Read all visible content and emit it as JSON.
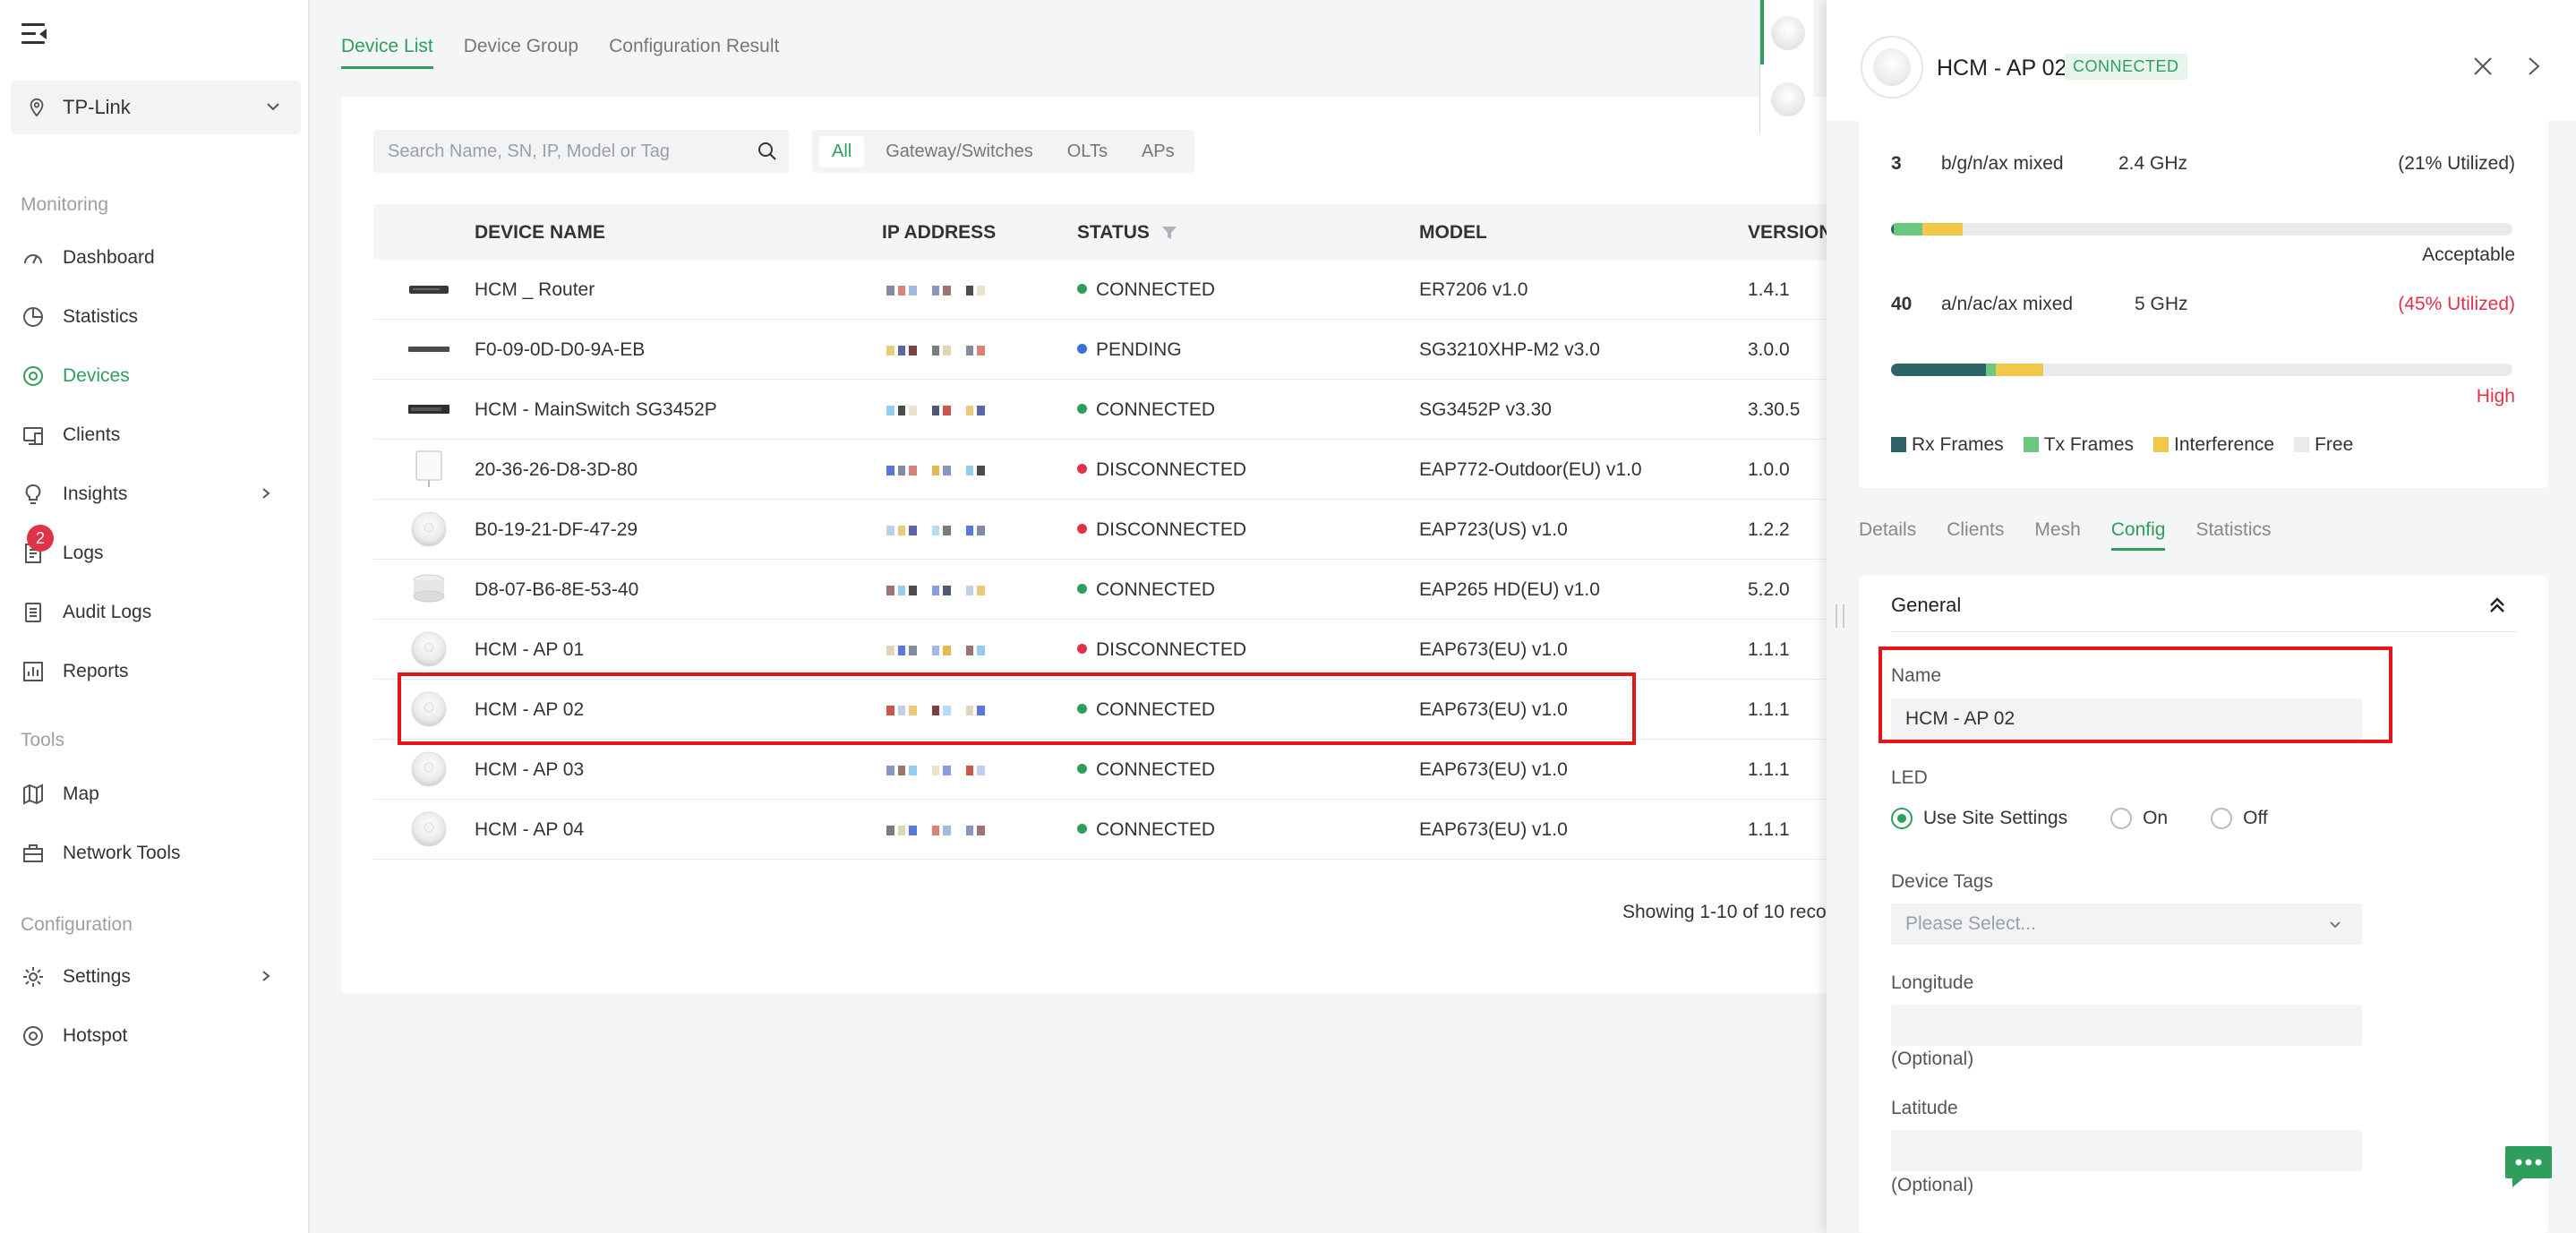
{
  "site": {
    "name": "TP-Link"
  },
  "nav": {
    "sections": {
      "monitoring": "Monitoring",
      "tools": "Tools",
      "configuration": "Configuration"
    },
    "items": [
      {
        "label": "Dashboard",
        "icon": "dashboard-icon"
      },
      {
        "label": "Statistics",
        "icon": "pie-chart-icon"
      },
      {
        "label": "Devices",
        "icon": "devices-icon",
        "active": true
      },
      {
        "label": "Clients",
        "icon": "clients-icon"
      },
      {
        "label": "Insights",
        "icon": "lightbulb-icon"
      },
      {
        "label": "Logs",
        "icon": "logs-icon",
        "badge": "2"
      },
      {
        "label": "Audit Logs",
        "icon": "audit-icon"
      },
      {
        "label": "Reports",
        "icon": "reports-icon"
      },
      {
        "label": "Map",
        "icon": "map-icon"
      },
      {
        "label": "Network Tools",
        "icon": "toolbox-icon"
      },
      {
        "label": "Settings",
        "icon": "gear-icon"
      },
      {
        "label": "Hotspot",
        "icon": "hotspot-icon"
      }
    ]
  },
  "tabs": [
    "Device List",
    "Device Group",
    "Configuration Result"
  ],
  "search": {
    "placeholder": "Search Name, SN, IP, Model or Tag"
  },
  "filters": [
    "All",
    "Gateway/Switches",
    "OLTs",
    "APs"
  ],
  "table": {
    "headers": {
      "name": "DEVICE NAME",
      "ip": "IP ADDRESS",
      "status": "STATUS",
      "model": "MODEL",
      "version": "VERSION"
    },
    "rows": [
      {
        "name": "HCM _ Router",
        "status": "CONNECTED",
        "model": "ER7206 v1.0",
        "version": "1.4.1",
        "kind": "router"
      },
      {
        "name": "F0-09-0D-D0-9A-EB",
        "status": "PENDING",
        "model": "SG3210XHP-M2 v3.0",
        "version": "3.0.0",
        "kind": "switch-small"
      },
      {
        "name": "HCM - MainSwitch SG3452P",
        "status": "CONNECTED",
        "model": "SG3452P v3.30",
        "version": "3.30.5",
        "kind": "switch"
      },
      {
        "name": "20-36-26-D8-3D-80",
        "status": "DISCONNECTED",
        "model": "EAP772-Outdoor(EU) v1.0",
        "version": "1.0.0",
        "kind": "outdoor"
      },
      {
        "name": "B0-19-21-DF-47-29",
        "status": "DISCONNECTED",
        "model": "EAP723(US) v1.0",
        "version": "1.2.2",
        "kind": "ap"
      },
      {
        "name": "D8-07-B6-8E-53-40",
        "status": "CONNECTED",
        "model": "EAP265 HD(EU) v1.0",
        "version": "5.2.0",
        "kind": "ap-stack"
      },
      {
        "name": "HCM - AP 01",
        "status": "DISCONNECTED",
        "model": "EAP673(EU) v1.0",
        "version": "1.1.1",
        "kind": "ap"
      },
      {
        "name": "HCM - AP 02",
        "status": "CONNECTED",
        "model": "EAP673(EU) v1.0",
        "version": "1.1.1",
        "kind": "ap"
      },
      {
        "name": "HCM - AP 03",
        "status": "CONNECTED",
        "model": "EAP673(EU) v1.0",
        "version": "1.1.1",
        "kind": "ap"
      },
      {
        "name": "HCM - AP 04",
        "status": "CONNECTED",
        "model": "EAP673(EU) v1.0",
        "version": "1.1.1",
        "kind": "ap"
      }
    ],
    "pager": "Showing 1-10 of 10 reco"
  },
  "colors": {
    "accent": "#2f9e5d",
    "connected": "#2f9e5d",
    "pending": "#3a6fd8",
    "disconnected": "#e0334a",
    "rx": "#2e6466",
    "tx": "#6cc77f",
    "interference": "#f1c94a",
    "free": "#e9eaec",
    "highlight": "#e5131a"
  },
  "drawer": {
    "title": "HCM - AP 02",
    "status": "CONNECTED",
    "radio24": {
      "channel": "3",
      "mode": "b/g/n/ax mixed",
      "band": "2.4 GHz",
      "util": "(21% Utilized)",
      "rating": "Acceptable",
      "rx": 0.005,
      "tx": 0.045,
      "interference": 0.065
    },
    "radio5": {
      "channel": "40",
      "mode": "a/n/ac/ax mixed",
      "band": "5 GHz",
      "util": "(45% Utilized)",
      "rating": "High",
      "rx": 0.153,
      "tx": 0.015,
      "interference": 0.077
    },
    "legend": [
      "Rx Frames",
      "Tx Frames",
      "Interference",
      "Free"
    ],
    "tabs": [
      "Details",
      "Clients",
      "Mesh",
      "Config",
      "Statistics"
    ],
    "config": {
      "section": "General",
      "name_label": "Name",
      "name_value": "HCM - AP 02",
      "led_label": "LED",
      "led_options": [
        "Use Site Settings",
        "On",
        "Off"
      ],
      "tags_label": "Device Tags",
      "tags_placeholder": "Please Select...",
      "longitude_label": "Longitude",
      "latitude_label": "Latitude",
      "optional": "(Optional)"
    }
  }
}
